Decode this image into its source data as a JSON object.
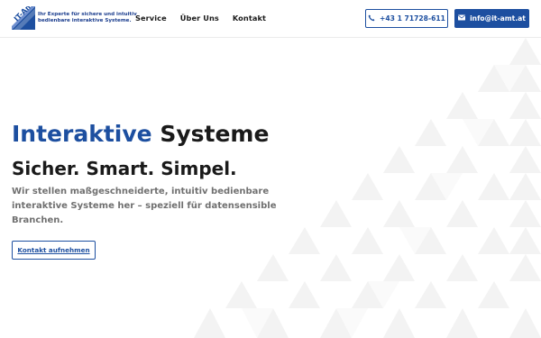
{
  "brand": {
    "logo_text": "IT-Amt",
    "tagline_line1": "Ihr Experte für sichere und intuitiv",
    "tagline_line2": "bedienbare interaktive Systeme."
  },
  "nav": {
    "items": [
      {
        "label": "Service"
      },
      {
        "label": "Über Uns"
      },
      {
        "label": "Kontakt"
      }
    ]
  },
  "contact": {
    "phone_label": "+43 1 71728-611",
    "phone_icon": "phone-icon",
    "email_label": "info@it-amt.at",
    "email_icon": "mail-icon"
  },
  "hero": {
    "title_accent": "Interaktive",
    "title_rest": "Systeme",
    "subtitle": "Sicher. Smart. Simpel.",
    "description": "Wir stellen maßgeschneiderte, intuitiv bedienbare interaktive Systeme her – speziell für datensensible Branchen.",
    "cta_label": "Kontakt aufnehmen"
  },
  "colors": {
    "accent": "#1d4fa0",
    "text": "#1a1a1a",
    "muted": "#707070",
    "pattern": "#f2f2f2"
  }
}
